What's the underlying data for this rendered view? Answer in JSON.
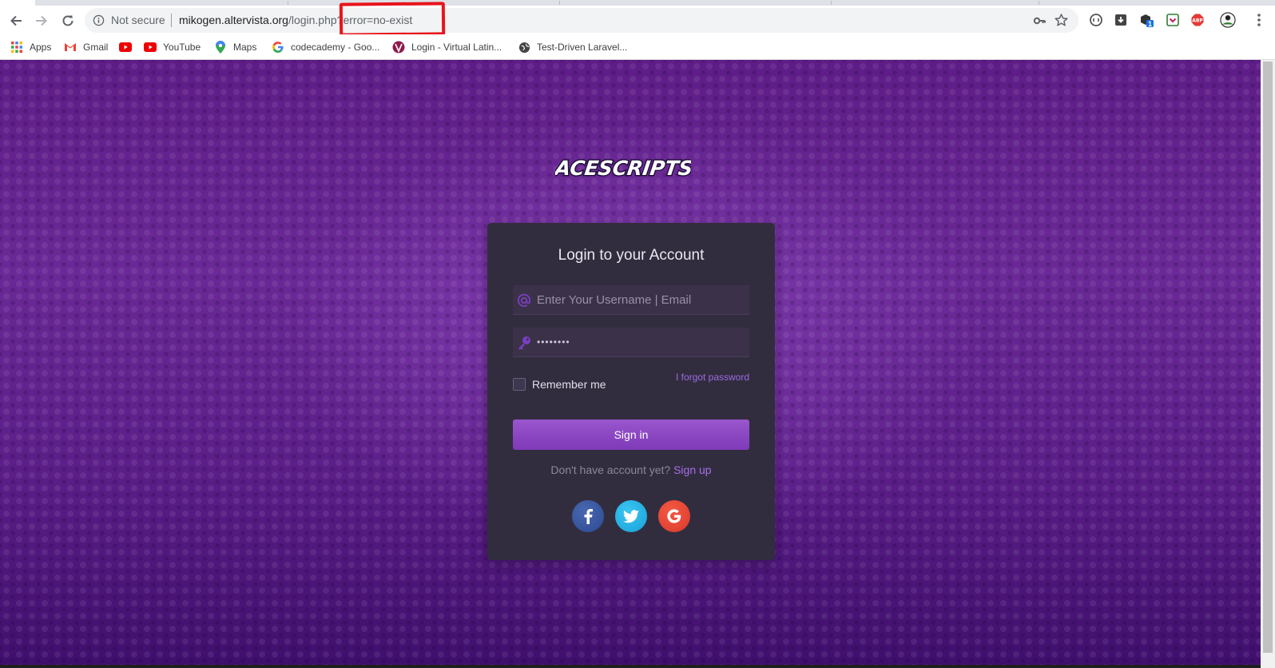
{
  "browser": {
    "security_label": "Not secure",
    "url_host": "mikogen.altervista.org",
    "url_path": "/login.php?error=no-exist",
    "bookmarks": [
      {
        "label": "Apps",
        "icon": "apps-grid-icon"
      },
      {
        "label": "Gmail",
        "icon": "gmail-icon"
      },
      {
        "label": "",
        "icon": "youtube-icon"
      },
      {
        "label": "YouTube",
        "icon": "youtube-icon"
      },
      {
        "label": "Maps",
        "icon": "maps-pin-icon"
      },
      {
        "label": "codecademy - Goo...",
        "icon": "google-g-icon"
      },
      {
        "label": "Login - Virtual Latin...",
        "icon": "site-logo-icon"
      },
      {
        "label": "Test-Driven Laravel...",
        "icon": "globe-icon"
      }
    ],
    "extension_badge": "1",
    "colors": {
      "annotation": "#e8141c",
      "omnibox": "#f1f3f4"
    }
  },
  "page": {
    "logo_text": "ACESCRIPTS",
    "card": {
      "title": "Login to your Account",
      "username_placeholder": "Enter Your Username | Email",
      "password_value": "********",
      "remember_label": "Remember me",
      "forgot_label": "I forgot password",
      "signin_label": "Sign in",
      "signup_prompt": "Don't have account yet?",
      "signup_link": "Sign up",
      "social": [
        "facebook-icon",
        "twitter-icon",
        "google-icon"
      ]
    },
    "colors": {
      "background": "#632391",
      "card": "#322d3e",
      "accent": "#8b46c2",
      "link": "#a46ee8",
      "facebook": "#3b5998",
      "twitter": "#1da1f2",
      "google": "#e2412f"
    }
  }
}
